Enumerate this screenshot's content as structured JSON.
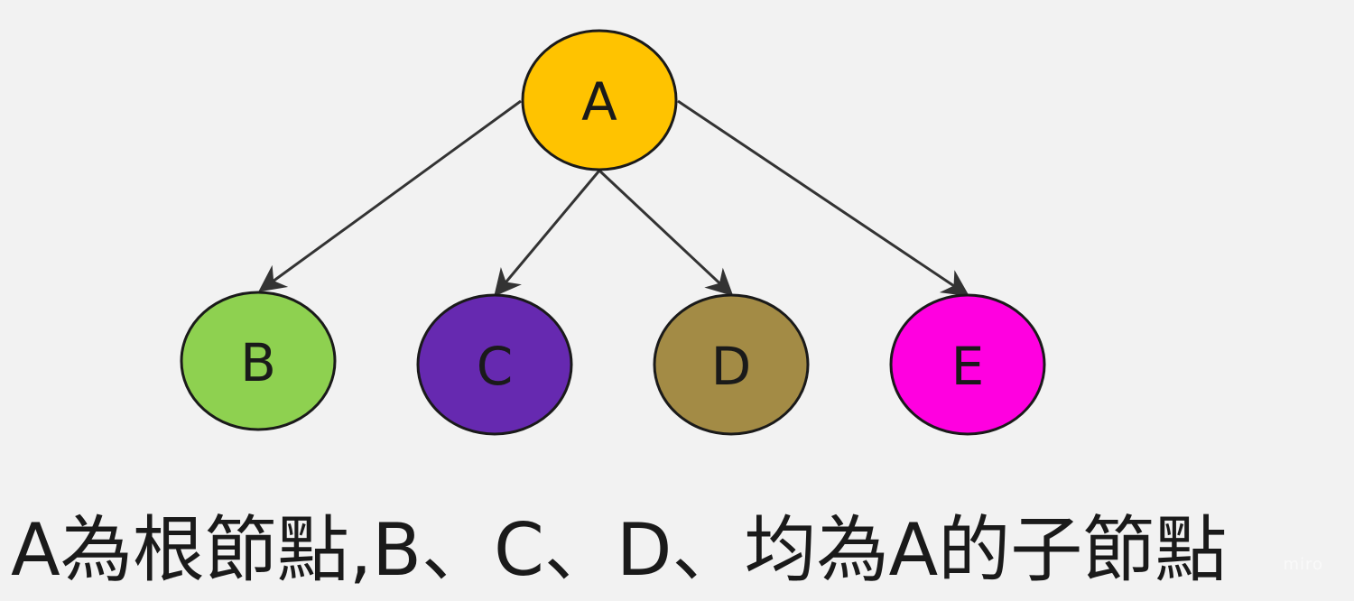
{
  "nodes": [
    {
      "id": "A",
      "label": "A",
      "color": "#FFC300"
    },
    {
      "id": "B",
      "label": "B",
      "color": "#8ED150"
    },
    {
      "id": "C",
      "label": "C",
      "color": "#6629B0"
    },
    {
      "id": "D",
      "label": "D",
      "color": "#A38B45"
    },
    {
      "id": "E",
      "label": "E",
      "color": "#FF00E0"
    }
  ],
  "edges": [
    {
      "from": "A",
      "to": "B"
    },
    {
      "from": "A",
      "to": "C"
    },
    {
      "from": "A",
      "to": "D"
    },
    {
      "from": "A",
      "to": "E"
    }
  ],
  "caption": "A為根節點,B、C、D、均為A的子節點",
  "watermark": "miro",
  "colors": {
    "background": "#F2F2F2",
    "stroke": "#1A1A1A",
    "edge": "#333333"
  }
}
